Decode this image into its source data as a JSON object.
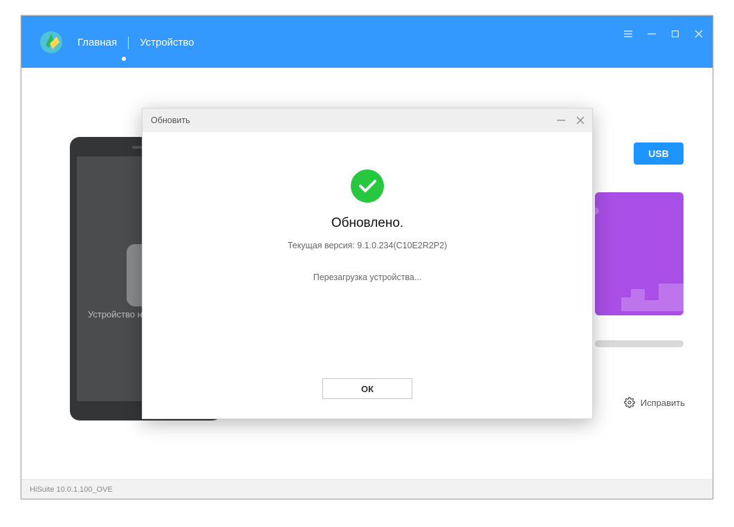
{
  "header": {
    "nav_home": "Главная",
    "nav_device": "Устройство"
  },
  "phone": {
    "status_text": "Устройство н"
  },
  "controls": {
    "usb_label": "USB",
    "fix_label": "Исправить"
  },
  "modal": {
    "title": "Обновить",
    "heading": "Обновлено.",
    "version_line": "Текущая версия: 9.1.0.234(C10E2R2P2)",
    "rebooting": "Перезагрузка устройства...",
    "ok_label": "ОК"
  },
  "statusbar": {
    "version": "HiSuite 10.0.1.100_OVE"
  }
}
